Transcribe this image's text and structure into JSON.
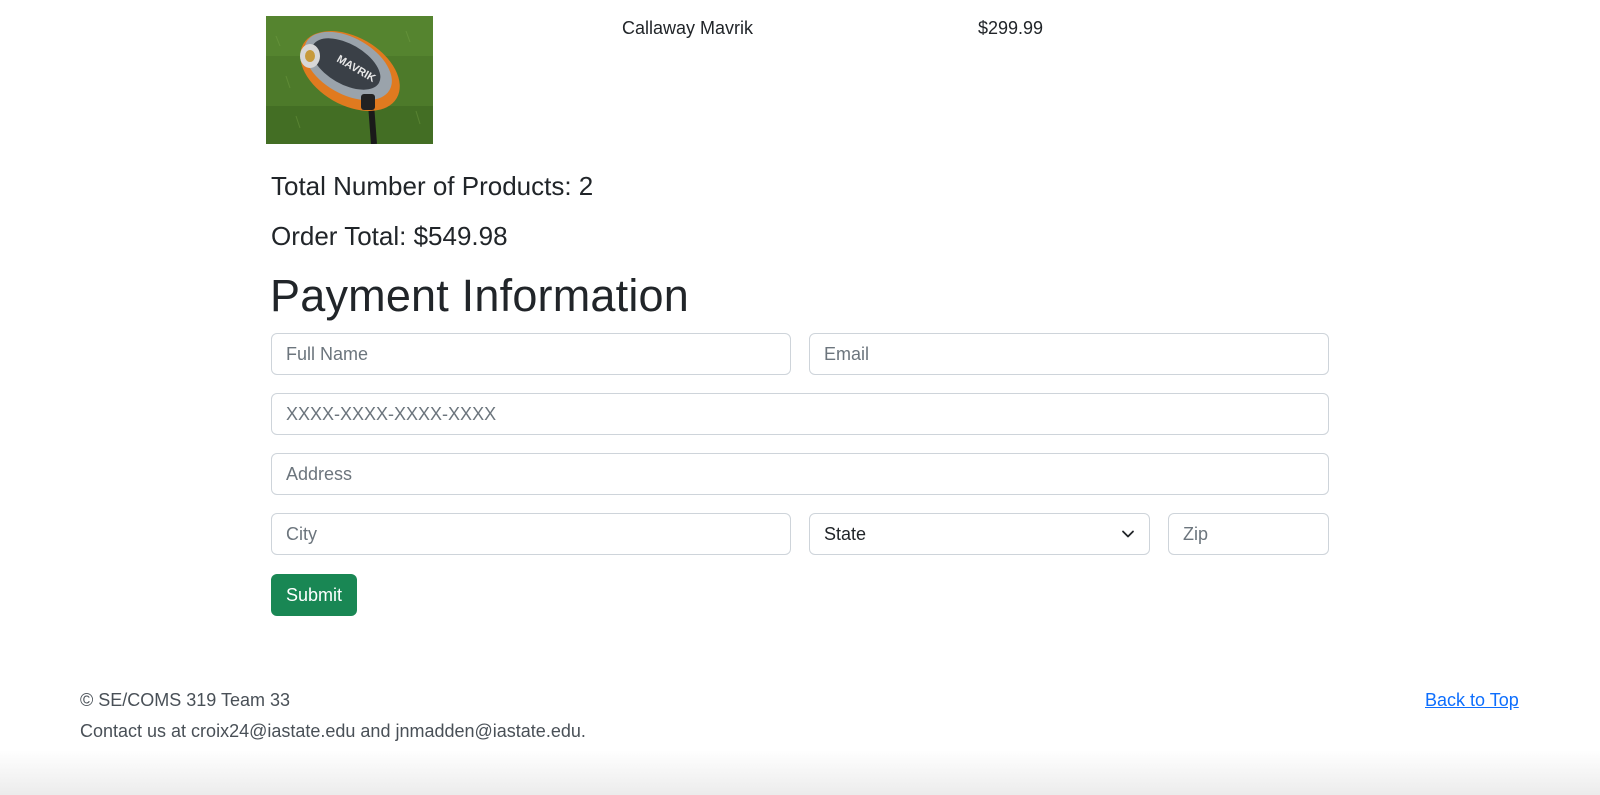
{
  "cart": {
    "item": {
      "name": "Callaway Mavrik",
      "price": "$299.99",
      "image_alt": "Callaway Mavrik driver on grass"
    },
    "total_products_text": "Total Number of Products: 2",
    "order_total_text": "Order Total: $549.98"
  },
  "payment": {
    "title": "Payment Information",
    "full_name_placeholder": "Full Name",
    "email_placeholder": "Email",
    "card_placeholder": "XXXX-XXXX-XXXX-XXXX",
    "address_placeholder": "Address",
    "city_placeholder": "City",
    "state_selected": "State",
    "zip_placeholder": "Zip",
    "submit_label": "Submit",
    "submit_color": "#198754"
  },
  "footer": {
    "copyright": "© SE/COMS 319 Team 33",
    "contact": "Contact us at croix24@iastate.edu and jnmadden@iastate.edu.",
    "back_to_top": "Back to Top",
    "link_color": "#0d6efd"
  }
}
